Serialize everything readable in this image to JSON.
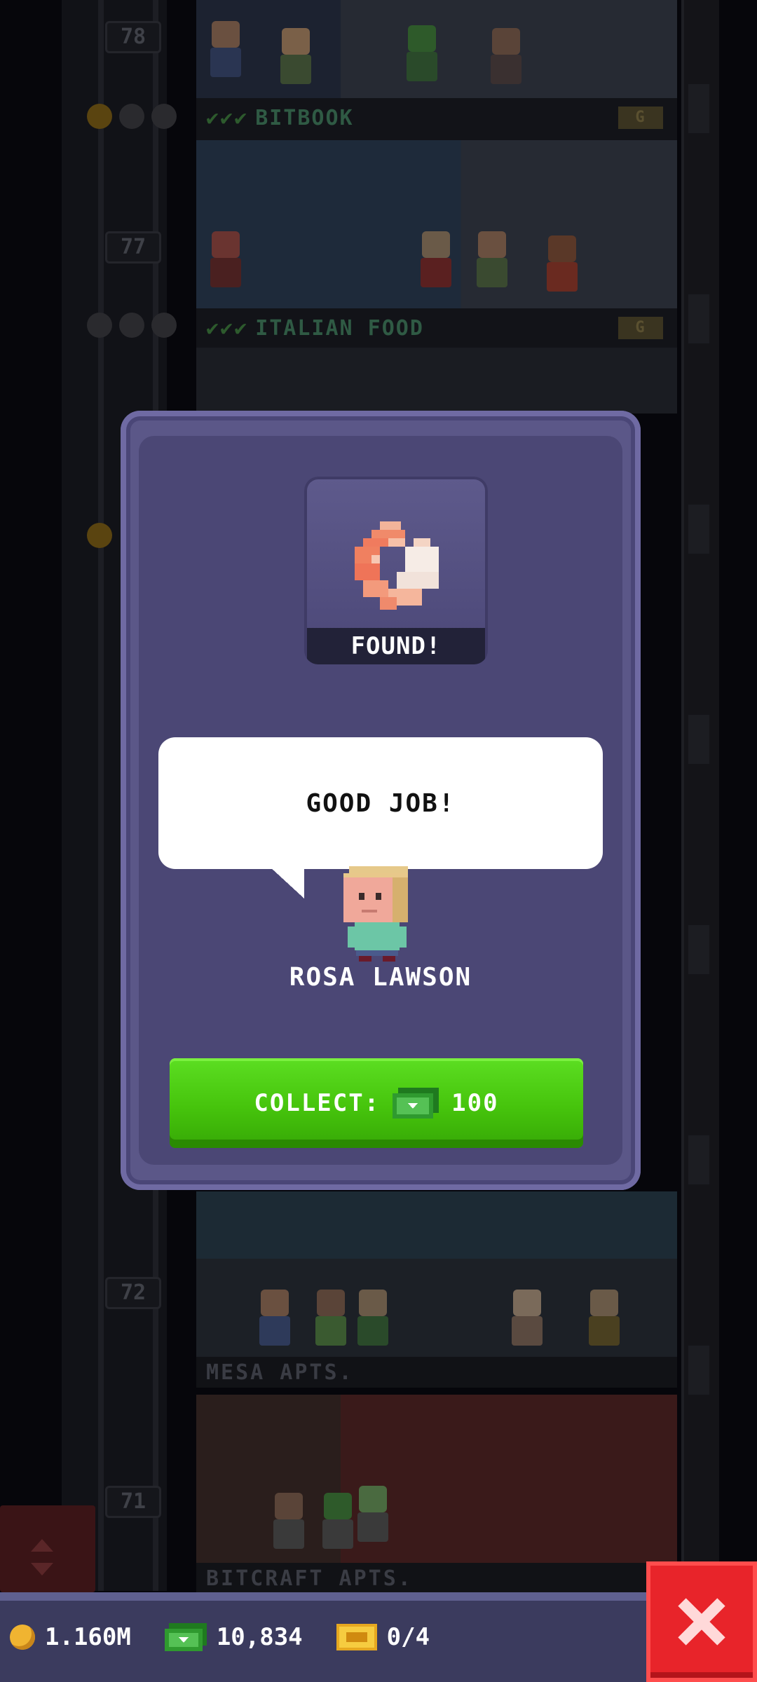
{
  "background": {
    "floors": [
      {
        "number": "78"
      },
      {
        "number": "77",
        "business": "BITBOOK",
        "ticks": "✔✔✔",
        "tag": "G"
      },
      {
        "number": "",
        "business": "ITALIAN FOOD",
        "ticks": "✔✔✔",
        "tag": "G"
      },
      {
        "number": "72"
      },
      {
        "number": "71"
      }
    ],
    "residences": [
      "MESA APTS.",
      "BITCRAFT APTS."
    ]
  },
  "modal": {
    "found_label": "FOUND!",
    "speech": "GOOD JOB!",
    "character_name": "ROSA LAWSON",
    "collect_label": "COLLECT:",
    "collect_amount": "100",
    "item_icon": "shrimp-icon"
  },
  "hud": {
    "coins": "1.160M",
    "bux": "10,834",
    "tickets": "0/4"
  },
  "colors": {
    "modal_bg": "#5b5788",
    "collect_green": "#46c40c",
    "close_red": "#e8242a"
  }
}
